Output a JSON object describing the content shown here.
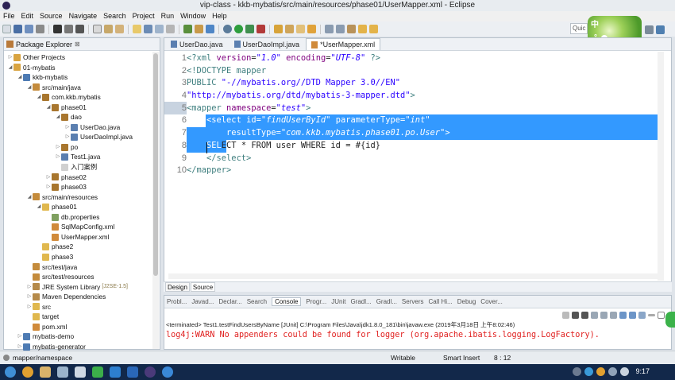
{
  "window": {
    "title": "vip-class - kkb-mybatis/src/main/resources/phase01/UserMapper.xml - Eclipse"
  },
  "menu": [
    "File",
    "Edit",
    "Source",
    "Navigate",
    "Search",
    "Project",
    "Run",
    "Window",
    "Help"
  ],
  "quick_access": {
    "text": "Quic"
  },
  "ime": {
    "char1": "中",
    "char2": "°"
  },
  "package_explorer": {
    "title": "Package Explorer",
    "close": "⊠",
    "items": [
      {
        "label": "Other Projects",
        "indent": 0,
        "icon": "working-set",
        "twisty": "▷"
      },
      {
        "label": "01-mybatis",
        "indent": 0,
        "icon": "working-set",
        "twisty": "◢"
      },
      {
        "label": "kkb-mybatis",
        "indent": 1,
        "icon": "project",
        "twisty": "◢"
      },
      {
        "label": "src/main/java",
        "indent": 2,
        "icon": "source-folder",
        "twisty": "◢"
      },
      {
        "label": "com.kkb.mybatis",
        "indent": 3,
        "icon": "package",
        "twisty": "◢"
      },
      {
        "label": "phase01",
        "indent": 4,
        "icon": "package",
        "twisty": "◢"
      },
      {
        "label": "dao",
        "indent": 5,
        "icon": "package",
        "twisty": "◢"
      },
      {
        "label": "UserDao.java",
        "indent": 6,
        "icon": "java-file",
        "twisty": "▷"
      },
      {
        "label": "UserDaoImpl.java",
        "indent": 6,
        "icon": "java-file",
        "twisty": "▷"
      },
      {
        "label": "po",
        "indent": 5,
        "icon": "package",
        "twisty": "▷"
      },
      {
        "label": "Test1.java",
        "indent": 5,
        "icon": "java-file",
        "twisty": "▷"
      },
      {
        "label": "入门案例",
        "indent": 5,
        "icon": "text-file",
        "twisty": ""
      },
      {
        "label": "phase02",
        "indent": 4,
        "icon": "package",
        "twisty": "▷"
      },
      {
        "label": "phase03",
        "indent": 4,
        "icon": "package",
        "twisty": "▷"
      },
      {
        "label": "src/main/resources",
        "indent": 2,
        "icon": "source-folder",
        "twisty": "◢"
      },
      {
        "label": "phase01",
        "indent": 3,
        "icon": "folder",
        "twisty": "◢"
      },
      {
        "label": "db.properties",
        "indent": 4,
        "icon": "properties-file",
        "twisty": ""
      },
      {
        "label": "SqlMapConfig.xml",
        "indent": 4,
        "icon": "xml-file",
        "twisty": ""
      },
      {
        "label": "UserMapper.xml",
        "indent": 4,
        "icon": "xml-file",
        "twisty": ""
      },
      {
        "label": "phase2",
        "indent": 3,
        "icon": "folder",
        "twisty": ""
      },
      {
        "label": "phase3",
        "indent": 3,
        "icon": "folder",
        "twisty": ""
      },
      {
        "label": "src/test/java",
        "indent": 2,
        "icon": "source-folder",
        "twisty": ""
      },
      {
        "label": "src/test/resources",
        "indent": 2,
        "icon": "source-folder",
        "twisty": ""
      },
      {
        "label": "JRE System Library",
        "indent": 2,
        "icon": "library",
        "twisty": "▷",
        "deco": "[J2SE-1.5]"
      },
      {
        "label": "Maven Dependencies",
        "indent": 2,
        "icon": "library",
        "twisty": "▷"
      },
      {
        "label": "src",
        "indent": 2,
        "icon": "folder",
        "twisty": "▷"
      },
      {
        "label": "target",
        "indent": 2,
        "icon": "folder",
        "twisty": ""
      },
      {
        "label": "pom.xml",
        "indent": 2,
        "icon": "xml-file",
        "twisty": ""
      },
      {
        "label": "mybatis-demo",
        "indent": 1,
        "icon": "project",
        "twisty": "▷"
      },
      {
        "label": "mybatis-generator",
        "indent": 1,
        "icon": "project",
        "twisty": "▷"
      }
    ]
  },
  "editor": {
    "tabs": [
      {
        "label": "UserDao.java",
        "active": false
      },
      {
        "label": "UserDaoImpl.java",
        "active": false
      },
      {
        "label": "*UserMapper.xml",
        "active": true
      }
    ],
    "lines": [
      {
        "n": "1",
        "html": "<span class='pi'>&lt;?xml </span><span class='attr'>version</span>=<span class='val'>\"1.0\"</span> <span class='attr'>encoding</span>=<span class='val'>\"UTF-8\"</span> <span class='pi'>?&gt;</span>"
      },
      {
        "n": "2",
        "html": "<span class='tag'>&lt;!DOCTYPE mapper</span>"
      },
      {
        "n": "3",
        "html": "<span class='tag'>PUBLIC </span><span class='val' style='font-style:normal'>\"-//mybatis.org//DTD Mapper 3.0//EN\"</span>"
      },
      {
        "n": "4",
        "html": "<span class='val' style='font-style:normal'>\"http://mybatis.org/dtd/mybatis-3-mapper.dtd\"</span><span class='tag'>&gt;</span>"
      },
      {
        "n": "5",
        "html": "<span class='tag'>&lt;mapper </span><span class='attr'>namespace</span>=<span class='val'>\"test\"</span><span class='tag'>&gt;</span>"
      },
      {
        "n": "6",
        "html": "    <span class='s-txt'>&lt;select id=<i>\"findUserById\"</i> parameterType=<i>\"int\"</i></span>"
      },
      {
        "n": "7",
        "html": "<span class='s-txt'>        resultType=<i>\"com.kkb.mybatis.phase01.po.User\"</i>&gt;</span>"
      },
      {
        "n": "8",
        "html": "<span class='s-txt'>    SEL</span>ECT * FROM user WHERE id = #{id}"
      },
      {
        "n": "9",
        "html": "    <span class='tag'>&lt;/select&gt;</span>"
      },
      {
        "n": "10",
        "html": "<span class='tag'>&lt;/mapper&gt;</span>"
      }
    ],
    "bottom_tabs": [
      "Design",
      "Source"
    ]
  },
  "console": {
    "tabs": [
      "Probl...",
      "Javad...",
      "Declar...",
      "Search",
      "Console",
      "Progr...",
      "JUnit",
      "Gradl...",
      "Gradl...",
      "Servers",
      "Call Hi...",
      "Debug",
      "Cover..."
    ],
    "active_tab": "Console",
    "terminated": "<terminated> Test1.testFindUsersByName [JUnit] C:\\Program Files\\Java\\jdk1.8.0_181\\bin\\javaw.exe (2019年3月18日 上午8:02:46)",
    "warning": "log4j:WARN No appenders could be found for logger (org.apache.ibatis.logging.LogFactory)."
  },
  "status": {
    "path": "mapper/namespace",
    "mode": "Writable",
    "insert": "Smart Insert",
    "position": "8 : 12"
  },
  "taskbar": {
    "clock": "9:17"
  },
  "colors": {
    "selection": "#3399ff",
    "tag": "#3f7f7f",
    "attr": "#7f007f",
    "value": "#2a00ff",
    "warn": "#e0201f",
    "taskbar": "#12284a"
  }
}
